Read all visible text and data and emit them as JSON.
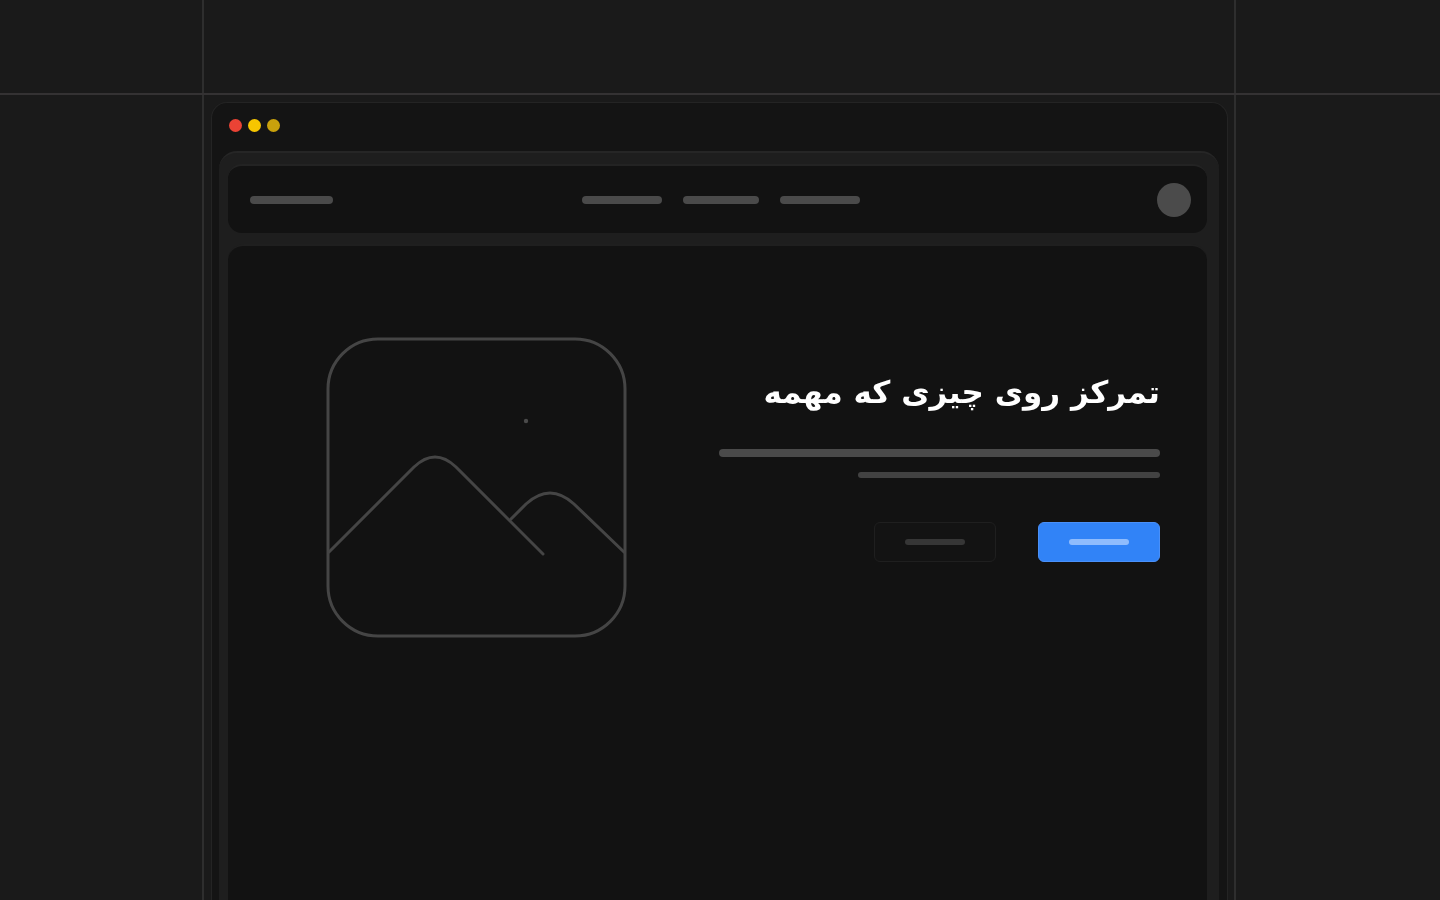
{
  "window": {
    "controls": [
      {
        "color": "#ea4335"
      },
      {
        "color": "#f7c600"
      },
      {
        "color": "#c9a10c"
      }
    ]
  },
  "hero": {
    "heading": "تمرکز روی چیزی که مهمه",
    "actions": [
      {
        "kind": "primary"
      },
      {
        "kind": "secondary"
      }
    ]
  }
}
